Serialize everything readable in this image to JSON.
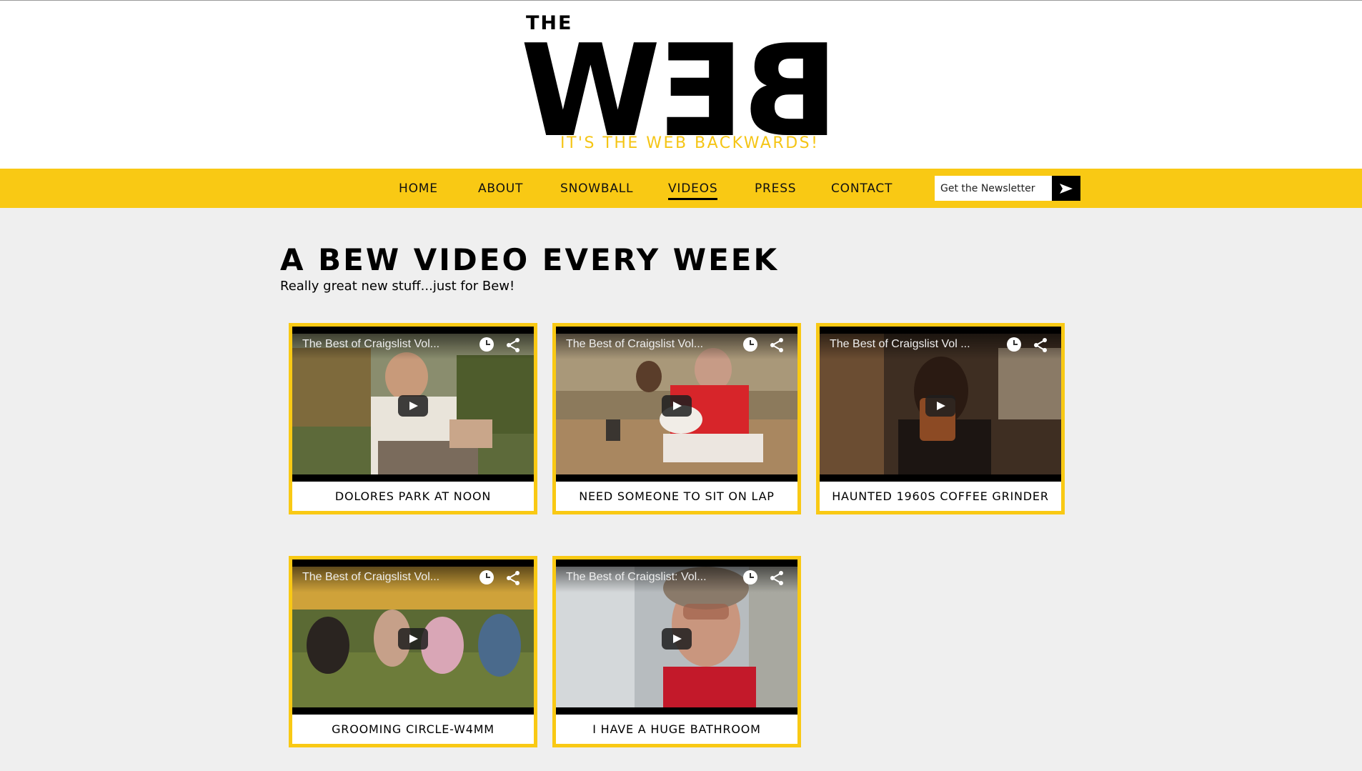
{
  "header": {
    "logo_the": "THE",
    "logo_word": "BEW",
    "tagline": "IT'S THE WEB BACKWARDS!"
  },
  "nav": {
    "items": [
      {
        "label": "HOME"
      },
      {
        "label": "ABOUT"
      },
      {
        "label": "SNOWBALL"
      },
      {
        "label": "VIDEOS",
        "active": true
      },
      {
        "label": "PRESS"
      },
      {
        "label": "CONTACT"
      }
    ],
    "newsletter_placeholder": "Get the Newsletter"
  },
  "main": {
    "title": "A BEW VIDEO EVERY WEEK",
    "subtitle": "Really great new stuff...just for Bew!",
    "videos": [
      {
        "player_title": "The Best of Craigslist Vol...",
        "caption": "DOLORES PARK AT NOON"
      },
      {
        "player_title": "The Best of Craigslist Vol...",
        "caption": "NEED SOMEONE TO SIT ON LAP"
      },
      {
        "player_title": "The Best of Craigslist Vol ...",
        "caption": "HAUNTED 1960S COFFEE GRINDER"
      },
      {
        "player_title": "The Best of Craigslist Vol...",
        "caption": "GROOMING CIRCLE-W4MM"
      },
      {
        "player_title": "The Best of Craigslist: Vol...",
        "caption": "I HAVE A HUGE BATHROOM"
      }
    ]
  },
  "colors": {
    "accent_yellow": "#f9c914",
    "tagline_yellow": "#f5c515",
    "page_bg": "#efefef"
  },
  "icons": [
    "clock-icon",
    "share-icon",
    "play-icon",
    "arrow-right-icon"
  ]
}
